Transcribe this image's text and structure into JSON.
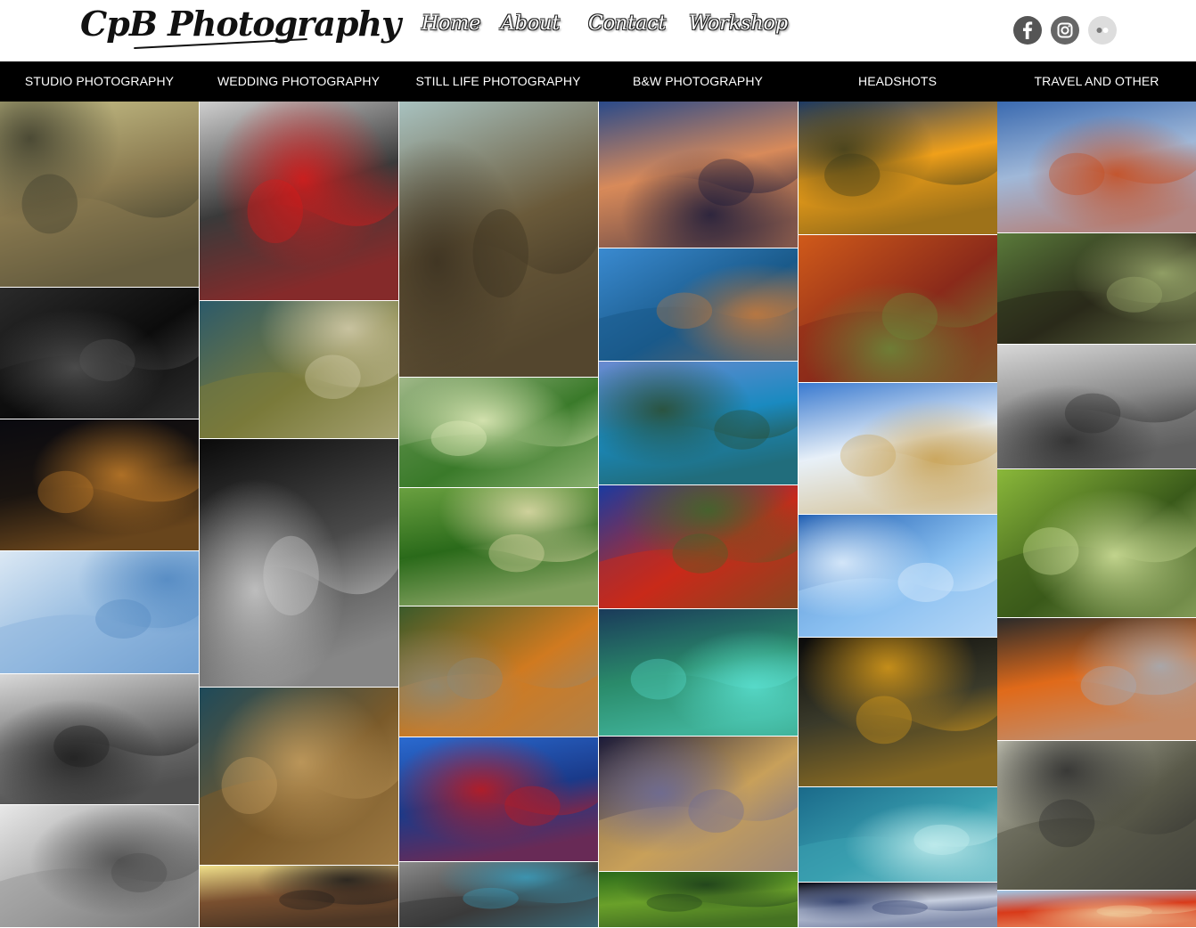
{
  "site": {
    "logo_text": "CpB Photography"
  },
  "top_nav": [
    {
      "label": "Home",
      "name": "nav-home"
    },
    {
      "label": "About",
      "name": "nav-about"
    },
    {
      "label": "Contact",
      "name": "nav-contact"
    },
    {
      "label": "Workshop",
      "name": "nav-workshop"
    }
  ],
  "social": [
    {
      "icon": "facebook-icon",
      "color": "#555555"
    },
    {
      "icon": "instagram-icon",
      "color": "#666666"
    },
    {
      "icon": "flickr-icon",
      "color": "#dddddd"
    }
  ],
  "categories": [
    {
      "label": "STUDIO PHOTOGRAPHY",
      "name": "category-studio-photography"
    },
    {
      "label": "WEDDING PHOTOGRAPHY",
      "name": "category-wedding-photography"
    },
    {
      "label": "STILL LIFE PHOTOGRAPHY",
      "name": "category-still-life-photography"
    },
    {
      "label": "B&W PHOTOGRAPHY",
      "name": "category-bw-photography"
    },
    {
      "label": "HEADSHOTS",
      "name": "category-headshots"
    },
    {
      "label": "TRAVEL AND OTHER",
      "name": "category-travel-and-other"
    }
  ],
  "gallery": [
    [
      {
        "subject": "vintage-bicycle-street",
        "colors": [
          "#c9c38a",
          "#8a7a50",
          "#3a3a2a"
        ]
      },
      {
        "subject": "sunglasses",
        "colors": [
          "#2a2a2a",
          "#0c0c0c",
          "#555555"
        ]
      },
      {
        "subject": "city-lights-bokeh",
        "colors": [
          "#0a0a10",
          "#1a1410",
          "#c8802a"
        ]
      },
      {
        "subject": "water-splash-rose",
        "colors": [
          "#dbe8f4",
          "#8fb7de",
          "#4f86c0"
        ]
      },
      {
        "subject": "turtle-bw",
        "colors": [
          "#d8d8d8",
          "#7a7a7a",
          "#1e1e1e"
        ]
      },
      {
        "subject": "mushroom-cloud",
        "colors": [
          "#e8e8e8",
          "#9a9a9a",
          "#4a4a4a"
        ]
      }
    ],
    [
      {
        "subject": "red-umbrella-bridge",
        "colors": [
          "#cfcfcf",
          "#3a3a3a",
          "#e01818"
        ]
      },
      {
        "subject": "spiral-staircase-cloud",
        "colors": [
          "#2c5a6a",
          "#7a7a3a",
          "#d8d0b0"
        ]
      },
      {
        "subject": "cat-profile-bw",
        "colors": [
          "#0a0a0a",
          "#4a4a4a",
          "#cfcfcf"
        ]
      },
      {
        "subject": "girl-on-tree",
        "colors": [
          "#1e4a5a",
          "#7a5a2a",
          "#c8a060"
        ]
      },
      {
        "subject": "house-at-sunset",
        "colors": [
          "#f0e08a",
          "#7a5030",
          "#1a1a1a"
        ]
      }
    ],
    [
      {
        "subject": "deer-on-hill",
        "colors": [
          "#a8c2c0",
          "#6a5a3a",
          "#3a3020"
        ]
      },
      {
        "subject": "tree-sunlight-park",
        "colors": [
          "#a0b888",
          "#3a7a2a",
          "#e8f0c0"
        ]
      },
      {
        "subject": "ducklings-in-grass",
        "colors": [
          "#6aa040",
          "#2a6a1a",
          "#e8e0b0"
        ]
      },
      {
        "subject": "tiger-on-rock",
        "colors": [
          "#3a5a2a",
          "#d07a20",
          "#8a8a7a"
        ]
      },
      {
        "subject": "heart-in-branches",
        "colors": [
          "#2a6ad0",
          "#1a3a8a",
          "#c81818"
        ]
      },
      {
        "subject": "cat-blue-eyes",
        "colors": [
          "#8a8a8a",
          "#3a3a3a",
          "#3aa0c0"
        ]
      }
    ],
    [
      {
        "subject": "burj-al-arab",
        "colors": [
          "#2a4a8a",
          "#d88a5a",
          "#1a1a3a"
        ]
      },
      {
        "subject": "mountain-lake",
        "colors": [
          "#3a8ad0",
          "#1a5a8a",
          "#c87a3a"
        ]
      },
      {
        "subject": "moraine-lake",
        "colors": [
          "#6a8ad0",
          "#1a8ac0",
          "#2a4a2a"
        ]
      },
      {
        "subject": "autumn-tree-valley",
        "colors": [
          "#1a3aa0",
          "#c82a1a",
          "#3a6a2a"
        ]
      },
      {
        "subject": "river-canyon",
        "colors": [
          "#1a3a5a",
          "#2a8a6a",
          "#5ae0d0"
        ]
      },
      {
        "subject": "city-skyline-night",
        "colors": [
          "#1a1a3a",
          "#c8a05a",
          "#6a6a9a"
        ]
      },
      {
        "subject": "green-forest",
        "colors": [
          "#2a6a1a",
          "#6aa02a",
          "#1a3a1a"
        ]
      }
    ],
    [
      {
        "subject": "sunflowers-sunset",
        "colors": [
          "#1a3a6a",
          "#f0a01a",
          "#3a3a1a"
        ]
      },
      {
        "subject": "autumn-stream",
        "colors": [
          "#d05a1a",
          "#8a2a1a",
          "#6a8a3a"
        ]
      },
      {
        "subject": "wheat-field-sky",
        "colors": [
          "#3a7ad0",
          "#e8f0f8",
          "#c8a050"
        ]
      },
      {
        "subject": "snowflake",
        "colors": [
          "#1a5ab0",
          "#8ac0f0",
          "#e8f4ff"
        ]
      },
      {
        "subject": "glowing-crater",
        "colors": [
          "#0a0a0a",
          "#3a3a2a",
          "#e0a01a"
        ]
      },
      {
        "subject": "jellyfish",
        "colors": [
          "#1a6a8a",
          "#3aa0b0",
          "#c8f0f0"
        ]
      },
      {
        "subject": "planet-in-space",
        "colors": [
          "#050510",
          "#c8d0e0",
          "#2a3a6a"
        ]
      }
    ],
    [
      {
        "subject": "frost-twig-macro",
        "colors": [
          "#3a6ab0",
          "#a0b8d8",
          "#c84a1a"
        ]
      },
      {
        "subject": "marble-on-wood",
        "colors": [
          "#5a7a3a",
          "#2a2a1a",
          "#a0b070"
        ]
      },
      {
        "subject": "motorcycle-stunt",
        "colors": [
          "#d8d8d8",
          "#8a8a8a",
          "#2a2a2a"
        ]
      },
      {
        "subject": "green-forest-path",
        "colors": [
          "#8ab83a",
          "#3a5a1a",
          "#d8e8a0"
        ]
      },
      {
        "subject": "orange-flowers-beach",
        "colors": [
          "#2a2a2a",
          "#e06a1a",
          "#a0b0c0"
        ]
      },
      {
        "subject": "eiffel-tower-paris",
        "colors": [
          "#c8c8b8",
          "#5a5a4a",
          "#2a2a2a"
        ]
      },
      {
        "subject": "hot-air-balloons",
        "colors": [
          "#a0c8e8",
          "#d83a1a",
          "#f0d0a0"
        ]
      }
    ]
  ]
}
